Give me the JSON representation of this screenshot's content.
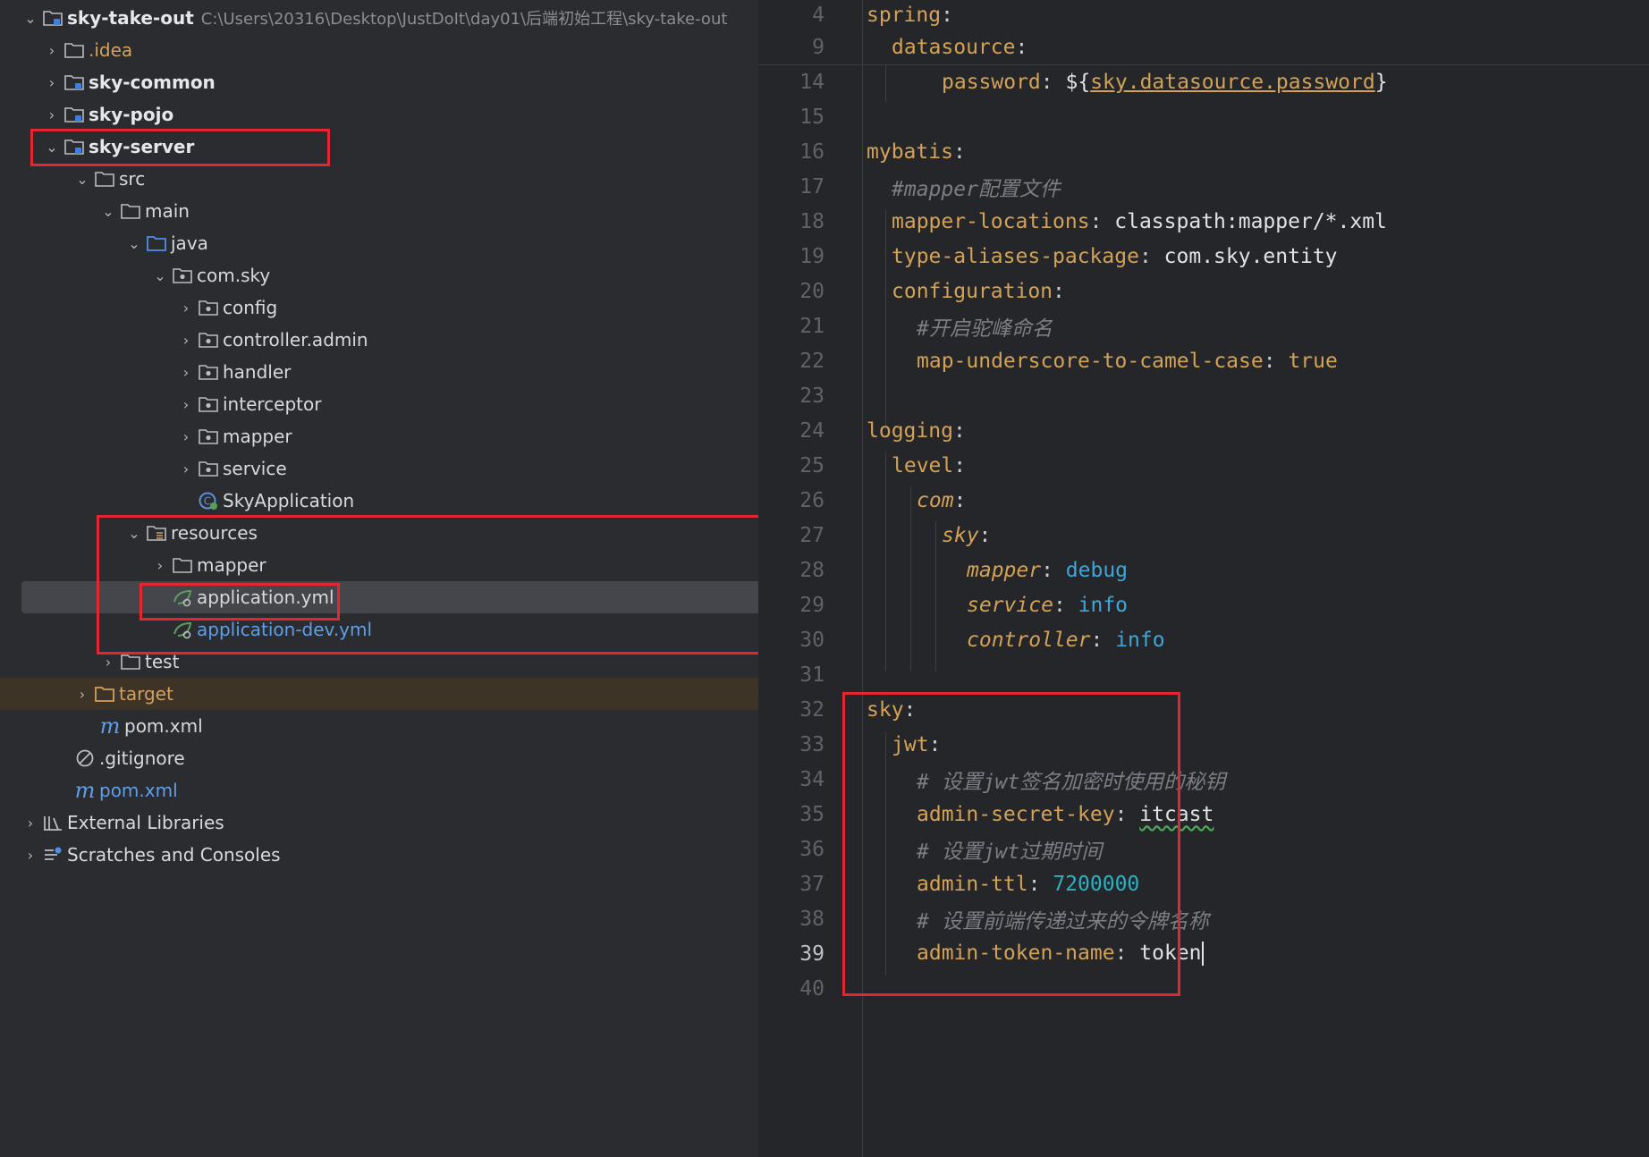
{
  "project_tree": {
    "root": {
      "label": "sky-take-out",
      "path": "C:\\Users\\20316\\Desktop\\JustDoIt\\day01\\后端初始工程\\sky-take-out"
    },
    "idea": ".idea",
    "sky_common": "sky-common",
    "sky_pojo": "sky-pojo",
    "sky_server": "sky-server",
    "src": "src",
    "main": "main",
    "java": "java",
    "com_sky": "com.sky",
    "packages": [
      "config",
      "controller.admin",
      "handler",
      "interceptor",
      "mapper",
      "service"
    ],
    "sky_application": "SkyApplication",
    "resources": "resources",
    "res_mapper": "mapper",
    "application_yml": "application.yml",
    "application_dev_yml": "application-dev.yml",
    "test": "test",
    "target": "target",
    "server_pom": "pom.xml",
    "gitignore": ".gitignore",
    "root_pom": "pom.xml",
    "pom_icon_letter": "m",
    "external_libraries": "External Libraries",
    "scratches": "Scratches and Consoles",
    "selected_item": "application.yml",
    "highlight_color": "#e3262f"
  },
  "editor": {
    "file": "application.yml",
    "current_line": "39",
    "sticky": [
      {
        "ln": "4",
        "key": "spring",
        "sep": ":"
      },
      {
        "ln": "9",
        "key": "datasource",
        "sep": ":"
      }
    ],
    "lines": {
      "l14": {
        "ln": "14",
        "key": "password",
        "sep": ": ",
        "pre": "${",
        "ref": "sky.datasource.password",
        "post": "}"
      },
      "l15": {
        "ln": "15"
      },
      "l16": {
        "ln": "16",
        "key": "mybatis",
        "sep": ":"
      },
      "l17": {
        "ln": "17",
        "comment": "#mapper配置文件"
      },
      "l18": {
        "ln": "18",
        "key": "mapper-locations",
        "sep": ": ",
        "val": "classpath:mapper/*.xml"
      },
      "l19": {
        "ln": "19",
        "key": "type-aliases-package",
        "sep": ": ",
        "val": "com.sky.entity"
      },
      "l20": {
        "ln": "20",
        "key": "configuration",
        "sep": ":"
      },
      "l21": {
        "ln": "21",
        "comment": "#开启驼峰命名"
      },
      "l22": {
        "ln": "22",
        "key": "map-underscore-to-camel-case",
        "sep": ": ",
        "val": "true"
      },
      "l23": {
        "ln": "23"
      },
      "l24": {
        "ln": "24",
        "key": "logging",
        "sep": ":"
      },
      "l25": {
        "ln": "25",
        "key": "level",
        "sep": ":"
      },
      "l26": {
        "ln": "26",
        "key": "com",
        "sep": ":"
      },
      "l27": {
        "ln": "27",
        "key": "sky",
        "sep": ":"
      },
      "l28": {
        "ln": "28",
        "key": "mapper",
        "sep": ": ",
        "val": "debug"
      },
      "l29": {
        "ln": "29",
        "key": "service",
        "sep": ": ",
        "val": "info"
      },
      "l30": {
        "ln": "30",
        "key": "controller",
        "sep": ": ",
        "val": "info"
      },
      "l31": {
        "ln": "31"
      },
      "l32": {
        "ln": "32",
        "key": "sky",
        "sep": ":"
      },
      "l33": {
        "ln": "33",
        "key": "jwt",
        "sep": ":"
      },
      "l34": {
        "ln": "34",
        "comment": "# 设置jwt签名加密时使用的秘钥"
      },
      "l35": {
        "ln": "35",
        "key": "admin-secret-key",
        "sep": ": ",
        "val": "itcast"
      },
      "l36": {
        "ln": "36",
        "comment": "# 设置jwt过期时间"
      },
      "l37": {
        "ln": "37",
        "key": "admin-ttl",
        "sep": ": ",
        "val": "7200000"
      },
      "l38": {
        "ln": "38",
        "comment": "# 设置前端传递过来的令牌名称"
      },
      "l39": {
        "ln": "39",
        "key": "admin-token-name",
        "sep": ": ",
        "val": "token"
      },
      "l40": {
        "ln": "40"
      }
    }
  }
}
